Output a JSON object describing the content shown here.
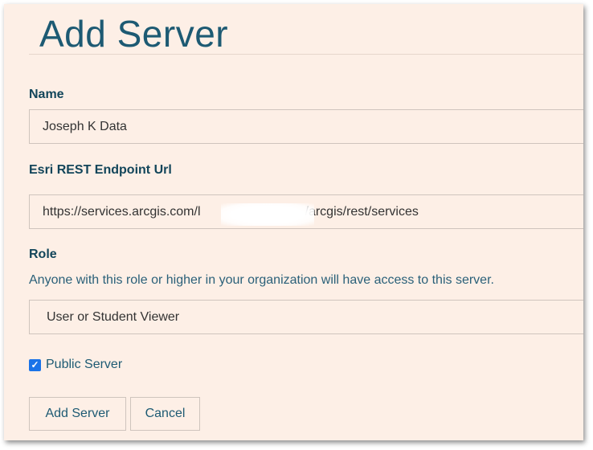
{
  "form": {
    "title": "Add Server",
    "name_label": "Name",
    "name_value": "Joseph K Data",
    "url_label": "Esri REST Endpoint Url",
    "url_value": "https://services.arcgis.com/l……………………………/arcgis/rest/services",
    "url_value_prefix": "https://services.arcgis.com/l",
    "url_value_suffix": "…/arcgis/rest/services",
    "role_label": "Role",
    "role_help": "Anyone with this role or higher in your organization will have access to this server.",
    "role_value": "User or Student Viewer",
    "public_label": "Public Server",
    "public_checked": true,
    "check_glyph": "✓",
    "submit_label": "Add Server",
    "cancel_label": "Cancel"
  },
  "colors": {
    "background": "#fdefe6",
    "title": "#1d5a73",
    "label": "#12455a",
    "checkbox": "#1a73e8"
  }
}
